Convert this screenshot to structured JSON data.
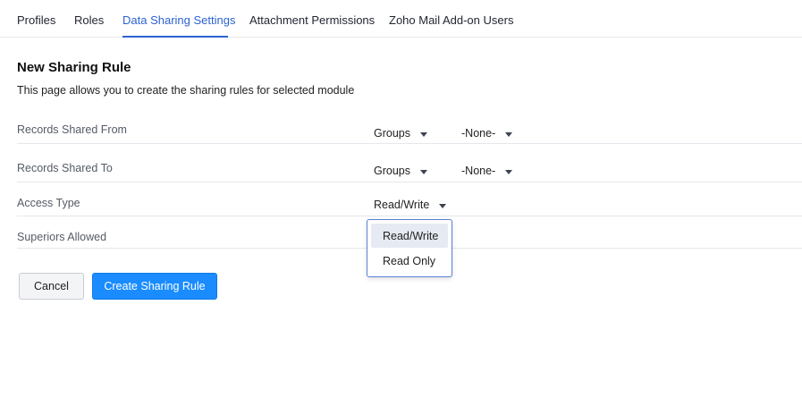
{
  "tabs": [
    {
      "label": "Profiles"
    },
    {
      "label": "Roles"
    },
    {
      "label": "Data Sharing Settings"
    },
    {
      "label": "Attachment Permissions"
    },
    {
      "label": "Zoho Mail Add-on Users"
    }
  ],
  "active_tab": "Data Sharing Settings",
  "page": {
    "title": "New Sharing Rule",
    "description": "This page allows you to create the sharing rules for selected module"
  },
  "form": {
    "shared_from": {
      "label": "Records Shared From",
      "type_value": "Groups",
      "entity_value": "-None-"
    },
    "shared_to": {
      "label": "Records Shared To",
      "type_value": "Groups",
      "entity_value": "-None-"
    },
    "access_type": {
      "label": "Access Type",
      "value": "Read/Write"
    },
    "superiors_allowed": {
      "label": "Superiors Allowed"
    }
  },
  "access_dropdown": {
    "options": [
      "Read/Write",
      "Read Only"
    ],
    "selected": "Read/Write"
  },
  "buttons": {
    "cancel": "Cancel",
    "create": "Create Sharing Rule"
  },
  "colors": {
    "accent": "#2d63d0",
    "primary_button": "#1a8cff"
  },
  "icons": {
    "dropdown": "caret-down-icon"
  }
}
